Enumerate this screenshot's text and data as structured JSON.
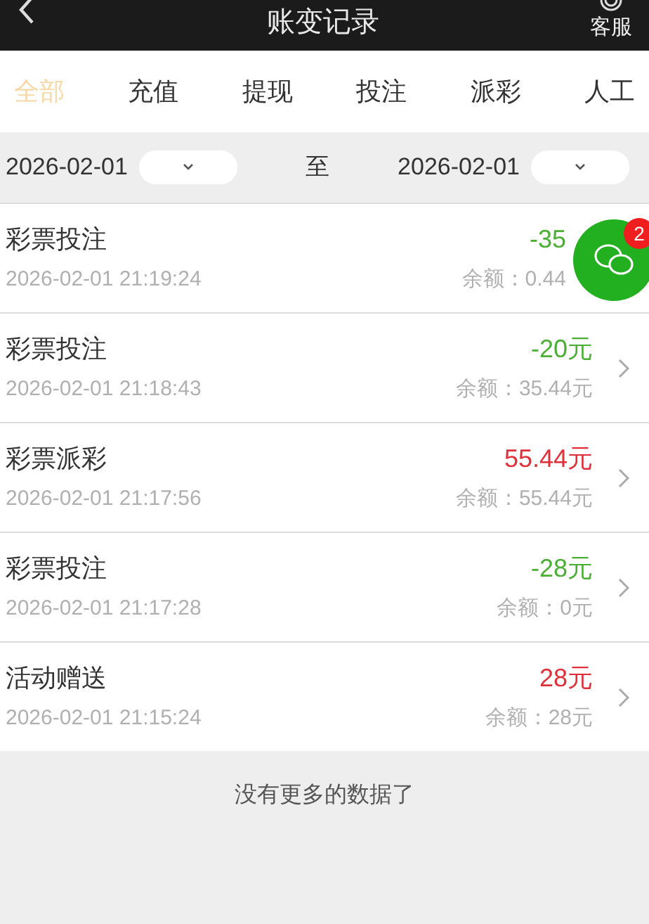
{
  "header": {
    "title": "账变记录",
    "service_label": "客服"
  },
  "tabs": [
    {
      "label": "全部",
      "selected": true
    },
    {
      "label": "充值",
      "selected": false
    },
    {
      "label": "提现",
      "selected": false
    },
    {
      "label": "投注",
      "selected": false
    },
    {
      "label": "派彩",
      "selected": false
    },
    {
      "label": "人工",
      "selected": false
    }
  ],
  "date_range": {
    "start": "2026-02-01",
    "separator": "至",
    "end": "2026-02-01"
  },
  "records": [
    {
      "title": "彩票投注",
      "time": "2026-02-01 21:19:24",
      "amount": "-35",
      "balance": "余额：0.44",
      "color": "#4caf35",
      "chevron": false
    },
    {
      "title": "彩票投注",
      "time": "2026-02-01 21:18:43",
      "amount": "-20元",
      "balance": "余额：35.44元",
      "color": "#4caf35",
      "chevron": true
    },
    {
      "title": "彩票派彩",
      "time": "2026-02-01 21:17:56",
      "amount": "55.44元",
      "balance": "余额：55.44元",
      "color": "#e0303a",
      "chevron": true
    },
    {
      "title": "彩票投注",
      "time": "2026-02-01 21:17:28",
      "amount": "-28元",
      "balance": "余额：0元",
      "color": "#4caf35",
      "chevron": true
    },
    {
      "title": "活动赠送",
      "time": "2026-02-01 21:15:24",
      "amount": "28元",
      "balance": "余额：28元",
      "color": "#e0303a",
      "chevron": true
    }
  ],
  "footer_note": "没有更多的数据了",
  "chat_button": {
    "badge": "2"
  }
}
